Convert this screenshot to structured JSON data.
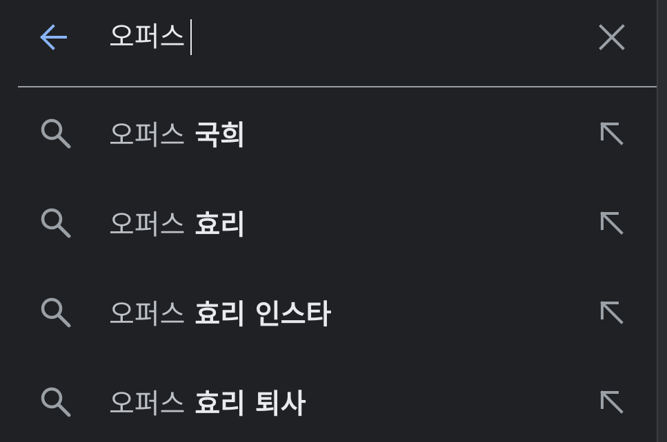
{
  "search": {
    "query": "오퍼스",
    "back_icon": "arrow-left-icon",
    "clear_icon": "close-icon"
  },
  "suggestions": [
    {
      "prefix": "오퍼스",
      "completion": "국희",
      "icon": "search-icon",
      "action_icon": "arrow-up-left-icon"
    },
    {
      "prefix": "오퍼스",
      "completion": "효리",
      "icon": "search-icon",
      "action_icon": "arrow-up-left-icon"
    },
    {
      "prefix": "오퍼스",
      "completion": "효리 인스타",
      "icon": "search-icon",
      "action_icon": "arrow-up-left-icon"
    },
    {
      "prefix": "오퍼스",
      "completion": "효리 퇴사",
      "icon": "search-icon",
      "action_icon": "arrow-up-left-icon"
    }
  ],
  "colors": {
    "background": "#202124",
    "accent": "#8ab4f8",
    "primary_text": "#e8eaed",
    "secondary_text": "#bdc1c6",
    "icon": "#9aa0a6"
  }
}
